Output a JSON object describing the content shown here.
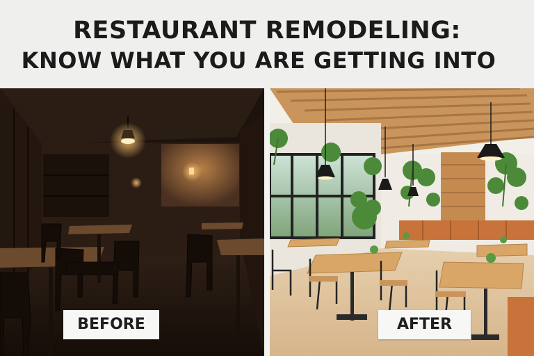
{
  "title": {
    "line1": "RESTAURANT REMODELING:",
    "line2": "KNOW WHAT YOU ARE GETTING INTO"
  },
  "panels": {
    "before": {
      "label": "BEFORE"
    },
    "after": {
      "label": "AFTER"
    }
  },
  "colors": {
    "background": "#efefed",
    "title_text": "#1b1b1b",
    "before_tone": "#2a1c12",
    "after_wood": "#c9955c"
  }
}
